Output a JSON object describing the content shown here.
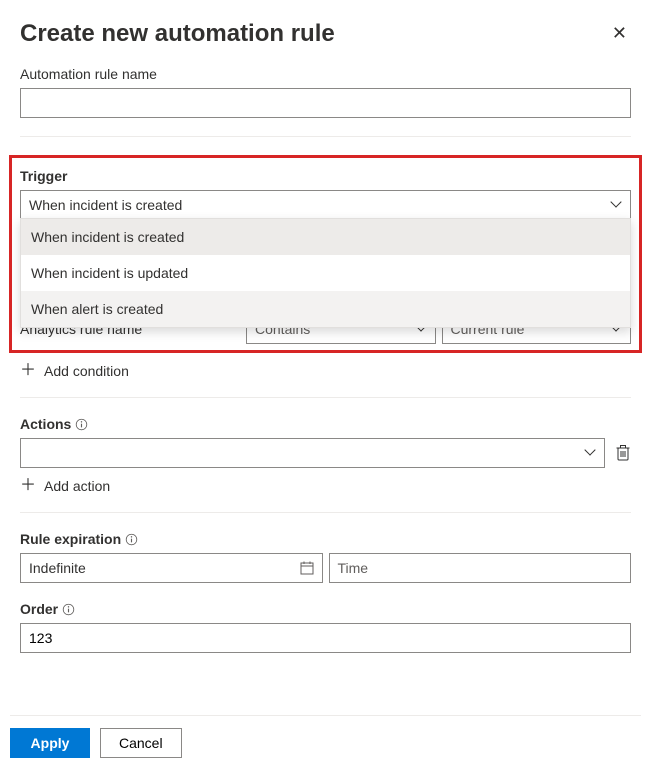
{
  "header": {
    "title": "Create new automation rule"
  },
  "name": {
    "label": "Automation rule name",
    "value": ""
  },
  "trigger": {
    "label": "Trigger",
    "selected": "When incident is created",
    "options": [
      "When incident is created",
      "When incident is updated",
      "When alert is created"
    ]
  },
  "conditions": {
    "row": {
      "field": "Analytics rule name",
      "operator": "Contains",
      "value": "Current rule"
    },
    "add_label": "Add condition"
  },
  "actions": {
    "label": "Actions",
    "selected": "",
    "add_label": "Add action"
  },
  "expiration": {
    "label": "Rule expiration",
    "date_value": "Indefinite",
    "time_placeholder": "Time"
  },
  "order": {
    "label": "Order",
    "value": "123"
  },
  "footer": {
    "apply": "Apply",
    "cancel": "Cancel"
  }
}
